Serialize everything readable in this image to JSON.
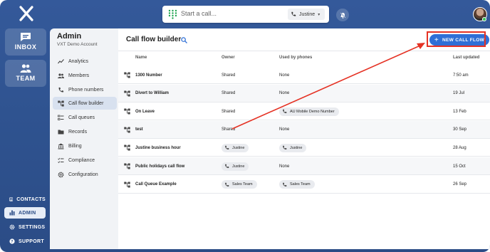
{
  "rail": {
    "inbox_label": "INBOX",
    "team_label": "TEAM",
    "links": [
      {
        "label": "CONTACTS",
        "icon": "contacts-icon",
        "active": false
      },
      {
        "label": "ADMIN",
        "icon": "bar-chart-icon",
        "active": true
      },
      {
        "label": "SETTINGS",
        "icon": "gear-icon",
        "active": false
      },
      {
        "label": "SUPPORT",
        "icon": "help-icon",
        "active": false
      }
    ]
  },
  "topbar": {
    "call_placeholder": "Start a call...",
    "caller_id": "Justine"
  },
  "sidebar": {
    "title": "Admin",
    "account": "VXT Demo Account",
    "items": [
      {
        "label": "Analytics",
        "icon": "analytics-icon"
      },
      {
        "label": "Members",
        "icon": "members-icon"
      },
      {
        "label": "Phone numbers",
        "icon": "phone-icon"
      },
      {
        "label": "Call flow builder",
        "icon": "call-flow-icon"
      },
      {
        "label": "Call queues",
        "icon": "queue-icon"
      },
      {
        "label": "Records",
        "icon": "folder-icon"
      },
      {
        "label": "Billing",
        "icon": "bank-icon"
      },
      {
        "label": "Compliance",
        "icon": "checklist-icon"
      },
      {
        "label": "Configuration",
        "icon": "gear-icon"
      }
    ],
    "active_index": 3
  },
  "main": {
    "title": "Call flow builder",
    "new_button": "NEW CALL FLOW",
    "columns": {
      "name": "Name",
      "owner": "Owner",
      "used_by": "Used by phones",
      "last_updated": "Last updated"
    },
    "rows": [
      {
        "name": "1300 Number",
        "owner": "Shared",
        "owner_chip": false,
        "used": "None",
        "used_chip": false,
        "updated": "7:50 am"
      },
      {
        "name": "Divert to William",
        "owner": "Shared",
        "owner_chip": false,
        "used": "None",
        "used_chip": false,
        "updated": "19 Jul"
      },
      {
        "name": "On Leave",
        "owner": "Shared",
        "owner_chip": false,
        "used": "AU Mobile Demo Number",
        "used_chip": true,
        "updated": "13 Feb"
      },
      {
        "name": "test",
        "owner": "Shared",
        "owner_chip": false,
        "used": "None",
        "used_chip": false,
        "updated": "30 Sep"
      },
      {
        "name": "Justine business hour",
        "owner": "Justine",
        "owner_chip": true,
        "used": "Justine",
        "used_chip": true,
        "updated": "28 Aug"
      },
      {
        "name": "Public holidays call flow",
        "owner": "Justine",
        "owner_chip": true,
        "used": "None",
        "used_chip": false,
        "updated": "15 Oct"
      },
      {
        "name": "Call Queue Example",
        "owner": "Sales Team",
        "owner_chip": true,
        "used": "Sales Team",
        "used_chip": true,
        "updated": "26 Sep"
      }
    ]
  },
  "colors": {
    "accent": "#2f6fd6",
    "rail": "#2f5390",
    "annotation": "#e53224"
  }
}
